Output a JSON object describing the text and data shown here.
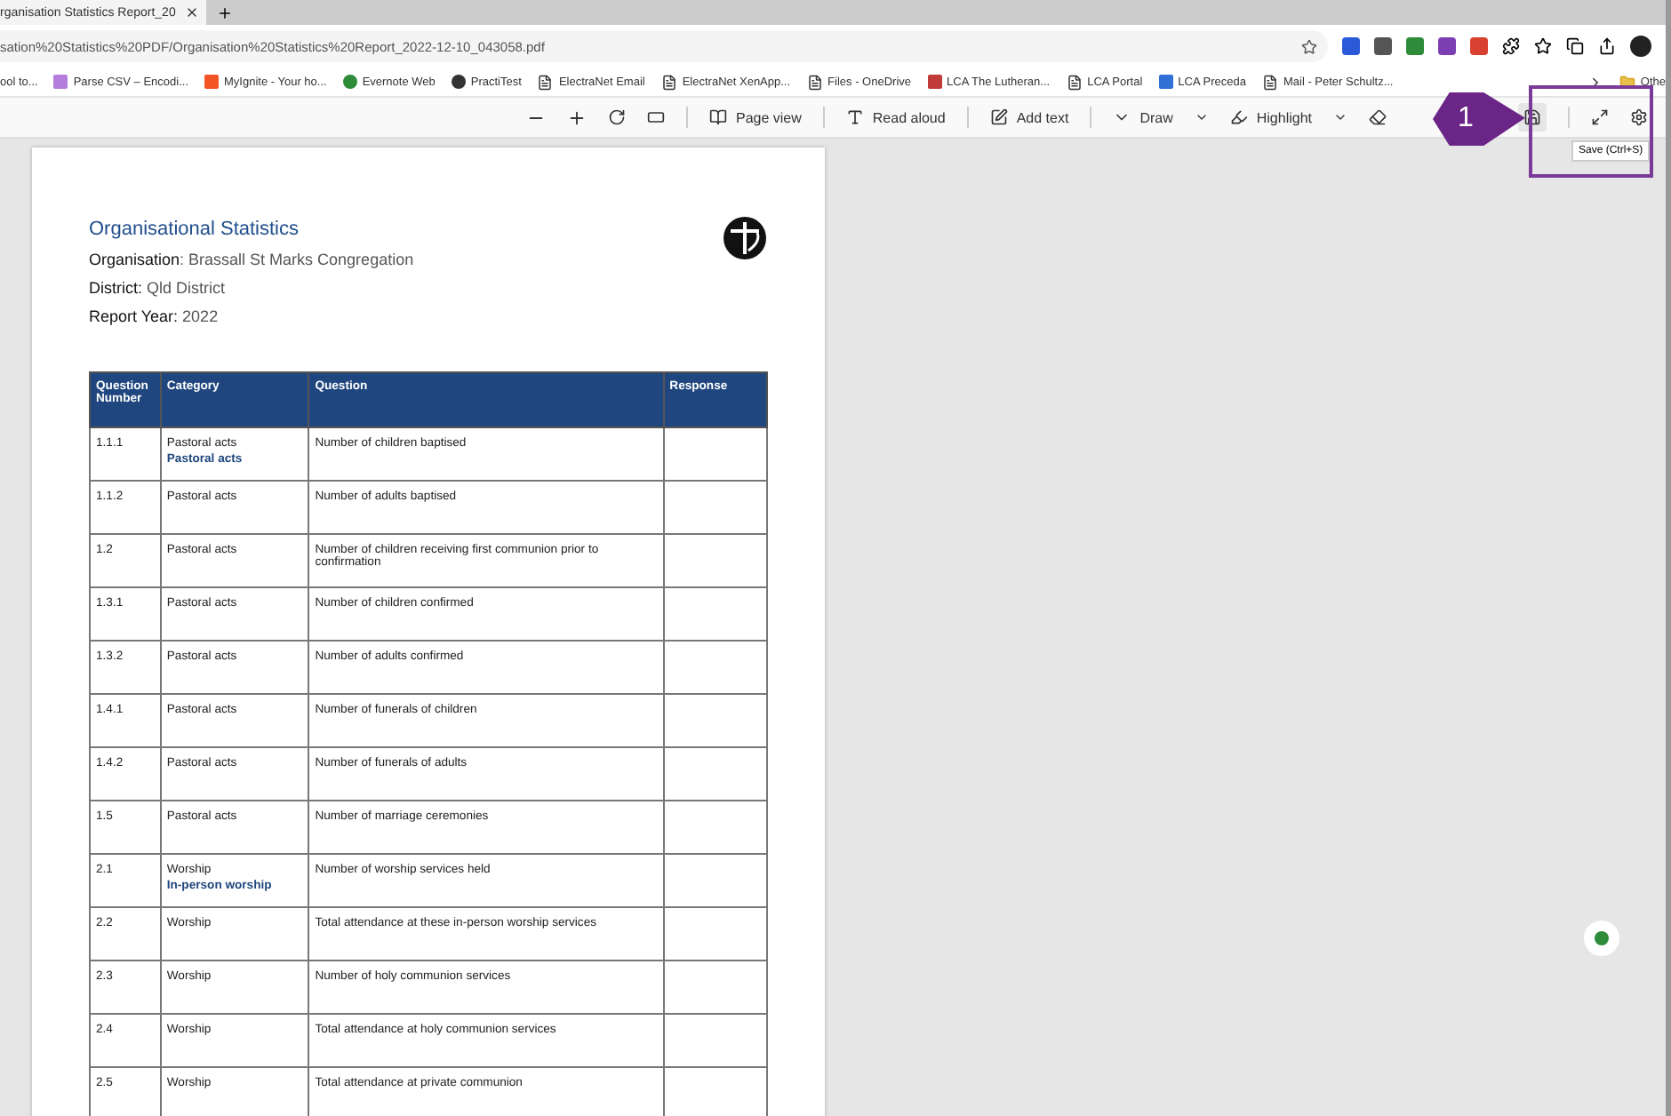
{
  "tab": {
    "title": "rganisation Statistics Report_20"
  },
  "address": {
    "url": "sation%20Statistics%20PDF/Organisation%20Statistics%20Report_2022-12-10_043058.pdf"
  },
  "bookmarks": [
    {
      "label": "ool to...",
      "kind": "none"
    },
    {
      "label": "Parse CSV – Encodi...",
      "kind": "stripes"
    },
    {
      "label": "MyIgnite - Your ho...",
      "kind": "tiles"
    },
    {
      "label": "Evernote Web",
      "kind": "leaf"
    },
    {
      "label": "PractiTest",
      "kind": "ring"
    },
    {
      "label": "ElectraNet Email",
      "kind": "page"
    },
    {
      "label": "ElectraNet XenApp...",
      "kind": "page"
    },
    {
      "label": "Files - OneDrive",
      "kind": "page"
    },
    {
      "label": "LCA  The Lutheran...",
      "kind": "globe"
    },
    {
      "label": "LCA Portal",
      "kind": "page"
    },
    {
      "label": "LCA Preceda",
      "kind": "p"
    },
    {
      "label": "Mail - Peter Schultz...",
      "kind": "page"
    },
    {
      "label": "Othe",
      "kind": "folder"
    }
  ],
  "pdf_toolbar": {
    "page_view": "Page view",
    "read_aloud": "Read aloud",
    "add_text": "Add text",
    "draw": "Draw",
    "highlight": "Highlight",
    "save_tooltip": "Save (Ctrl+S)"
  },
  "callout": {
    "number": "1"
  },
  "document": {
    "title": "Organisational Statistics",
    "fields": [
      {
        "label": "Organisation",
        "value": ": Brassall St Marks Congregation"
      },
      {
        "label": "District:",
        "value": " Qld District"
      },
      {
        "label": "Report Year:",
        "value": " 2022"
      }
    ],
    "table": {
      "columns": [
        "Question Number",
        "Category",
        "Question",
        "Response"
      ],
      "rows": [
        {
          "number": "1.1.1",
          "category": "Pastoral acts",
          "subcategory": "Pastoral acts",
          "question": "Number of children baptised"
        },
        {
          "number": "1.1.2",
          "category": "Pastoral acts",
          "question": "Number of adults baptised"
        },
        {
          "number": "1.2",
          "category": "Pastoral acts",
          "question": "Number of children receiving first communion prior to confirmation"
        },
        {
          "number": "1.3.1",
          "category": "Pastoral acts",
          "question": "Number of children confirmed"
        },
        {
          "number": "1.3.2",
          "category": "Pastoral acts",
          "question": "Number of adults confirmed"
        },
        {
          "number": "1.4.1",
          "category": "Pastoral acts",
          "question": "Number of funerals of children"
        },
        {
          "number": "1.4.2",
          "category": "Pastoral acts",
          "question": "Number of funerals of adults"
        },
        {
          "number": "1.5",
          "category": "Pastoral acts",
          "question": "Number of marriage ceremonies"
        },
        {
          "number": "2.1",
          "category": "Worship",
          "subcategory": "In-person worship",
          "question": "Number of worship services held"
        },
        {
          "number": "2.2",
          "category": "Worship",
          "question": "Total attendance at these in-person worship services"
        },
        {
          "number": "2.3",
          "category": "Worship",
          "question": "Number of holy communion services"
        },
        {
          "number": "2.4",
          "category": "Worship",
          "question": "Total attendance at holy communion services"
        },
        {
          "number": "2.5",
          "category": "Worship",
          "question": "Total attendance at private communion"
        }
      ]
    }
  }
}
